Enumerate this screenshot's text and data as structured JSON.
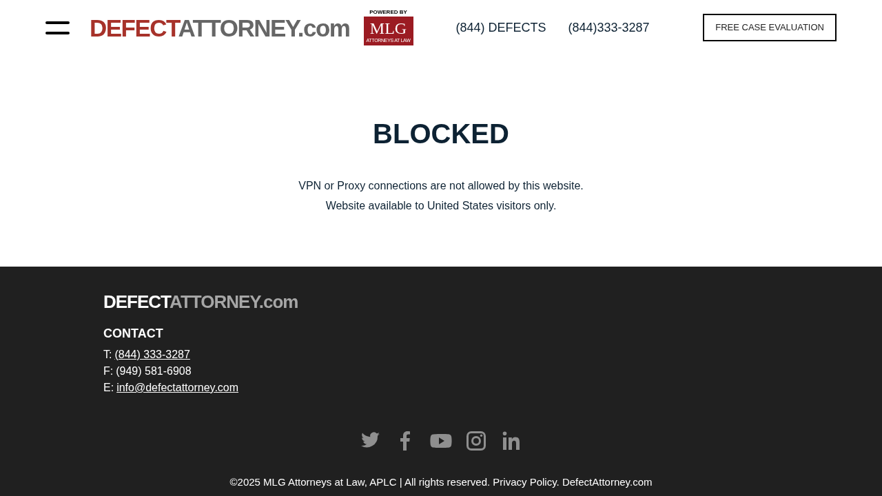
{
  "header": {
    "logo": {
      "part_1": "DEFECT",
      "part_2": "ATTORNEY.com"
    },
    "badge": {
      "caption": "POWERED BY",
      "mark": "MLG",
      "tagline": "ATTORNEYS AT LAW"
    },
    "phones": [
      "(844) DEFECTS",
      "(844)333-3287"
    ],
    "cta": "FREE CASE EVALUATION"
  },
  "main": {
    "title": "BLOCKED",
    "lines": [
      "VPN or Proxy connections are not allowed by this website.",
      "Website available to United States visitors only."
    ]
  },
  "footer": {
    "logo": {
      "part_1": "DEFECT",
      "part_2": "ATTORNEY.com"
    },
    "heading": "CONTACT",
    "contacts": [
      {
        "label": "T:",
        "value": "(844) 333-3287",
        "kind": "link"
      },
      {
        "label": "F:",
        "value": "(949) 581-6908",
        "kind": "plain"
      },
      {
        "label": "E:",
        "value": "info@defectattorney.com",
        "kind": "link"
      }
    ],
    "copyright": "©2025 MLG Attorneys at Law, APLC | All rights reserved. Privacy Policy. DefectAttorney.com"
  }
}
